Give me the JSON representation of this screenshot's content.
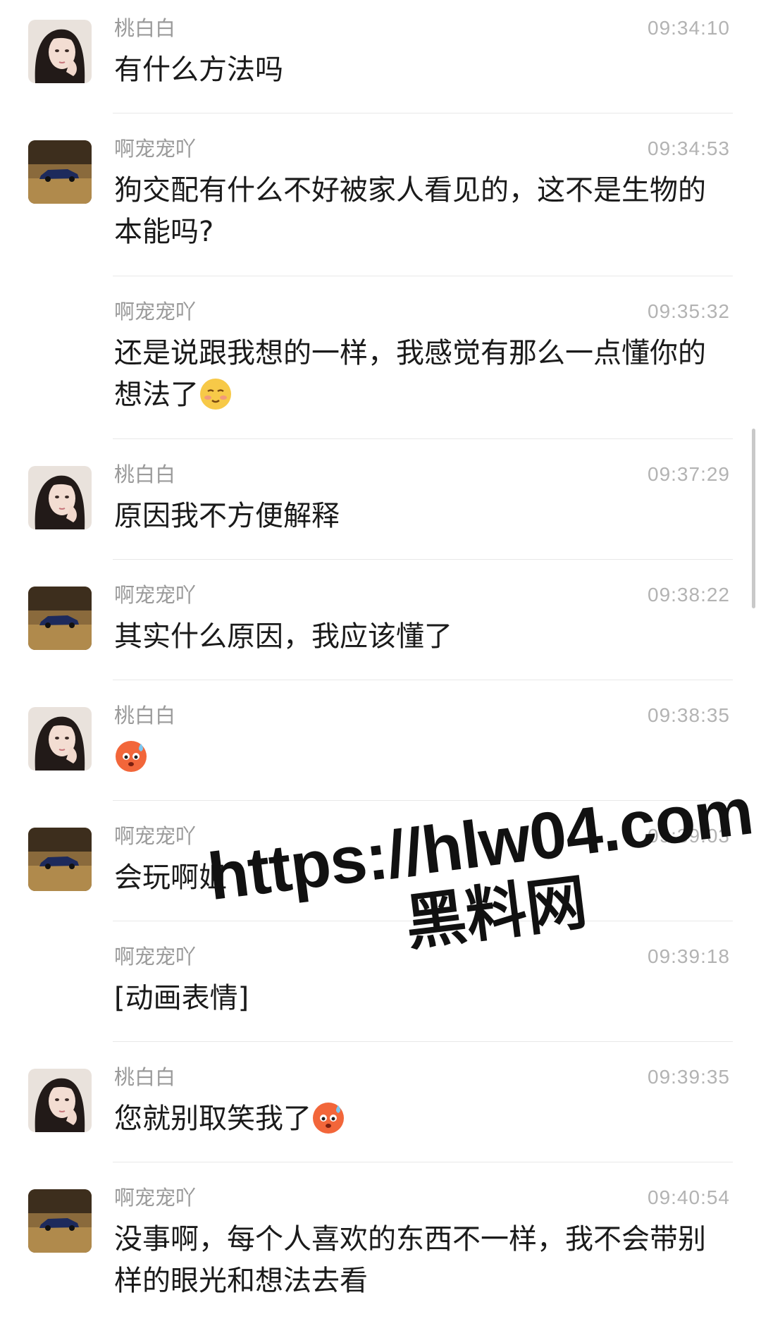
{
  "messages": [
    {
      "sender": "桃白白",
      "time": "09:34:10",
      "text": "有什么方法吗",
      "avatar": "portrait-avatar"
    },
    {
      "sender": "啊宠宠吖",
      "time": "09:34:53",
      "text": "狗交配有什么不好被家人看见的，这不是生物的\n本能吗?",
      "avatar": "car-avatar"
    },
    {
      "sender": "啊宠宠吖",
      "time": "09:35:32",
      "text": "还是说跟我想的一样，我感觉有那么一点懂你的\n想法了",
      "emoji": "blushing-face-emoji"
    },
    {
      "sender": "桃白白",
      "time": "09:37:29",
      "text": "原因我不方便解释",
      "avatar": "portrait-avatar"
    },
    {
      "sender": "啊宠宠吖",
      "time": "09:38:22",
      "text": "其实什么原因，我应该懂了",
      "avatar": "car-avatar"
    },
    {
      "sender": "桃白白",
      "time": "09:38:35",
      "text": "",
      "emoji": "sweating-face-emoji",
      "avatar": "portrait-avatar"
    },
    {
      "sender": "啊宠宠吖",
      "time": "09:39:03",
      "text": "会玩啊姐",
      "avatar": "car-avatar"
    },
    {
      "sender": "啊宠宠吖",
      "time": "09:39:18",
      "text": "[动画表情]"
    },
    {
      "sender": "桃白白",
      "time": "09:39:35",
      "text": "您就别取笑我了",
      "emoji": "sweating-face-emoji",
      "avatar": "portrait-avatar"
    },
    {
      "sender": "啊宠宠吖",
      "time": "09:40:54",
      "text": "没事啊，每个人喜欢的东西不一样，我不会带别\n样的眼光和想法去看",
      "avatar": "car-avatar"
    }
  ],
  "watermark": {
    "url": "https://hlw04.com",
    "name": "黑料网"
  },
  "colors": {
    "name": "#9a9a9a",
    "time": "#b3b3b3",
    "text": "#1a1a1a",
    "divider": "#e8e8e8"
  }
}
